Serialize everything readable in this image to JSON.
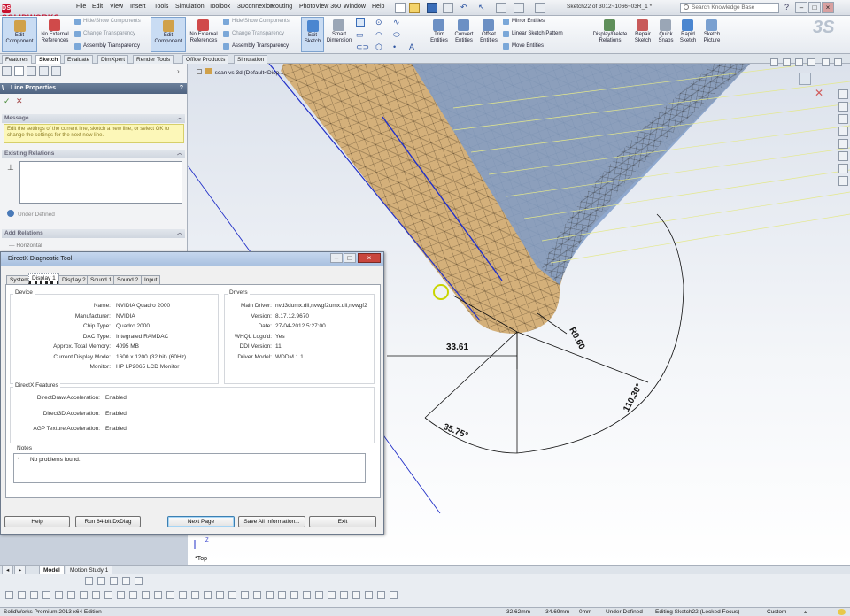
{
  "app": {
    "brand": "SOLIDWORKS",
    "menu": [
      "File",
      "Edit",
      "View",
      "Insert",
      "Tools",
      "Simulation",
      "Toolbox",
      "3Dconnexion",
      "Routing",
      "PhotoView 360",
      "Window",
      "Help"
    ],
    "document_title": "Sketch22 of 3012~1066~03R_1 *",
    "search_placeholder": "Search Knowledge Base"
  },
  "command_manager": {
    "edit_component_1": "Edit Component",
    "no_external_refs_1": "No External References",
    "hide_show_1": "Hide/Show Components",
    "change_transparency_1": "Change Transparency",
    "assembly_transparency_1": "Assembly Transparency",
    "edit_component_2": "Edit Component",
    "no_external_refs_2": "No External References",
    "hide_show_2": "Hide/Show Components",
    "change_transparency_2": "Change Transparency",
    "assembly_transparency_2": "Assembly Transparency",
    "exit_sketch": "Exit Sketch",
    "smart_dimension": "Smart Dimension",
    "trim_entities": "Trim Entities",
    "convert_entities": "Convert Entities",
    "offset_entities": "Offset Entities",
    "mirror_entities": "Mirror Entities",
    "linear_sketch_pattern": "Linear Sketch Pattern",
    "move_entities": "Move Entities",
    "display_delete_relations": "Display/Delete Relations",
    "repair_sketch": "Repair Sketch",
    "quick_snaps": "Quick Snaps",
    "rapid_sketch": "Rapid Sketch",
    "sketch_picture": "Sketch Picture"
  },
  "cm_tabs": [
    "Features",
    "Sketch",
    "Evaluate",
    "DimXpert",
    "Render Tools",
    "Office Products",
    "Simulation"
  ],
  "property_manager": {
    "title": "Line Properties",
    "message_header": "Message",
    "message_text": "Edit the settings of the current line, sketch a new line, or select OK to change the settings for the next new line.",
    "existing_relations_header": "Existing Relations",
    "under_defined": "Under Defined",
    "add_relations_header": "Add Relations",
    "add_relations_item": "Horizontal"
  },
  "feature_tree": {
    "item": "scan vs 3d  (Default<Disp..."
  },
  "viewport": {
    "dim_linear": "33.61",
    "dim_radius": "R0.60",
    "dim_angle_small": "35.75°",
    "dim_angle_large": "110.30°",
    "view_label": "*Top",
    "axis_label": "Z"
  },
  "dxdiag": {
    "title": "DirectX Diagnostic Tool",
    "tabs": [
      "System",
      "Display 1",
      "Display 2",
      "Sound 1",
      "Sound 2",
      "Input"
    ],
    "device_label": "Device",
    "drivers_label": "Drivers",
    "device": [
      {
        "k": "Name:",
        "v": "NVIDIA Quadro 2000"
      },
      {
        "k": "Manufacturer:",
        "v": "NVIDIA"
      },
      {
        "k": "Chip Type:",
        "v": "Quadro 2000"
      },
      {
        "k": "DAC Type:",
        "v": "Integrated RAMDAC"
      },
      {
        "k": "Approx. Total Memory:",
        "v": "4095 MB"
      },
      {
        "k": "Current Display Mode:",
        "v": "1600 x 1200 (32 bit) (60Hz)"
      },
      {
        "k": "Monitor:",
        "v": "HP LP2065 LCD Monitor"
      }
    ],
    "drivers": [
      {
        "k": "Main Driver:",
        "v": "nvd3dumx.dll,nvwgf2umx.dll,nvwgf2"
      },
      {
        "k": "Version:",
        "v": "8.17.12.9670"
      },
      {
        "k": "Date:",
        "v": "27-04-2012 5:27:00"
      },
      {
        "k": "WHQL Logo'd:",
        "v": "Yes"
      },
      {
        "k": "DDI Version:",
        "v": "11"
      },
      {
        "k": "Driver Model:",
        "v": "WDDM 1.1"
      }
    ],
    "features_label": "DirectX Features",
    "features": [
      {
        "k": "DirectDraw Acceleration:",
        "v": "Enabled"
      },
      {
        "k": "Direct3D Acceleration:",
        "v": "Enabled"
      },
      {
        "k": "AGP Texture Acceleration:",
        "v": "Enabled"
      }
    ],
    "notes_label": "Notes",
    "notes": "No problems found.",
    "buttons": {
      "help": "Help",
      "run64": "Run 64-bit DxDiag",
      "next_page": "Next Page",
      "save_all": "Save All Information...",
      "exit": "Exit"
    }
  },
  "bottom_tabs": [
    "Model",
    "Motion Study 1"
  ],
  "status": {
    "edition": "SolidWorks Premium 2013 x64 Edition",
    "x": "32.62mm",
    "y": "-34.69mm",
    "z": "0mm",
    "state": "Under Defined",
    "editing": "Editing Sketch22 (Locked Focus)",
    "units": "Custom"
  },
  "colors": {
    "surface_tan": "#d4b07a",
    "surface_blue": "#7f9cc8",
    "sketch_blue": "#2230c8",
    "dimension_black": "#111111",
    "highlight_yellow": "#c8d400"
  }
}
